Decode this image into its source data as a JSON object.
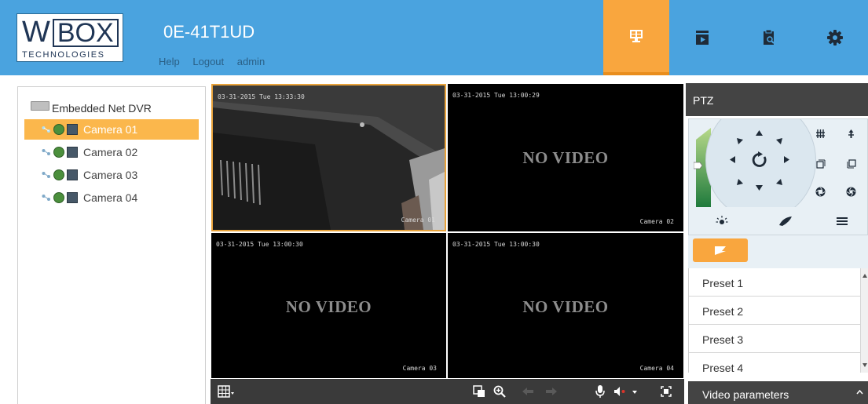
{
  "header": {
    "logo_main_w": "W",
    "logo_main_box": "BOX",
    "logo_sub": "TECHNOLOGIES",
    "device_name": "0E-41T1UD",
    "links": [
      "Help",
      "Logout",
      "admin"
    ],
    "nav_tabs": [
      {
        "name": "live-view",
        "icon": "monitor-icon",
        "active": true
      },
      {
        "name": "playback",
        "icon": "playback-icon",
        "active": false
      },
      {
        "name": "log",
        "icon": "log-search-icon",
        "active": false
      },
      {
        "name": "configuration",
        "icon": "gear-icon",
        "active": false
      }
    ],
    "accent_color": "#4aa3df",
    "active_color": "#f9a63e"
  },
  "tree": {
    "root_label": "Embedded Net DVR",
    "cameras": [
      {
        "label": "Camera 01",
        "selected": true
      },
      {
        "label": "Camera 02",
        "selected": false
      },
      {
        "label": "Camera 03",
        "selected": false
      },
      {
        "label": "Camera 04",
        "selected": false
      }
    ]
  },
  "video": {
    "panes": [
      {
        "time": "03-31-2015 Tue 13:33:30",
        "name": "Camera 01",
        "no_video": false,
        "selected": true
      },
      {
        "time": "03-31-2015 Tue 13:00:29",
        "name": "Camera 02",
        "no_video": true,
        "message": "NO VIDEO"
      },
      {
        "time": "03-31-2015 Tue 13:00:30",
        "name": "Camera 03",
        "no_video": true,
        "message": "NO VIDEO"
      },
      {
        "time": "03-31-2015 Tue 13:00:30",
        "name": "Camera 04",
        "no_video": true,
        "message": "NO VIDEO"
      }
    ],
    "toolbar_icons": [
      "layout-grid-icon",
      "stop-all-icon",
      "zoom-in-icon",
      "previous-page-icon",
      "next-page-icon",
      "microphone-icon",
      "volume-icon",
      "fullscreen-icon"
    ]
  },
  "ptz": {
    "title": "PTZ",
    "presets": [
      "Preset 1",
      "Preset 2",
      "Preset 3",
      "Preset 4"
    ],
    "video_params_label": "Video parameters"
  }
}
